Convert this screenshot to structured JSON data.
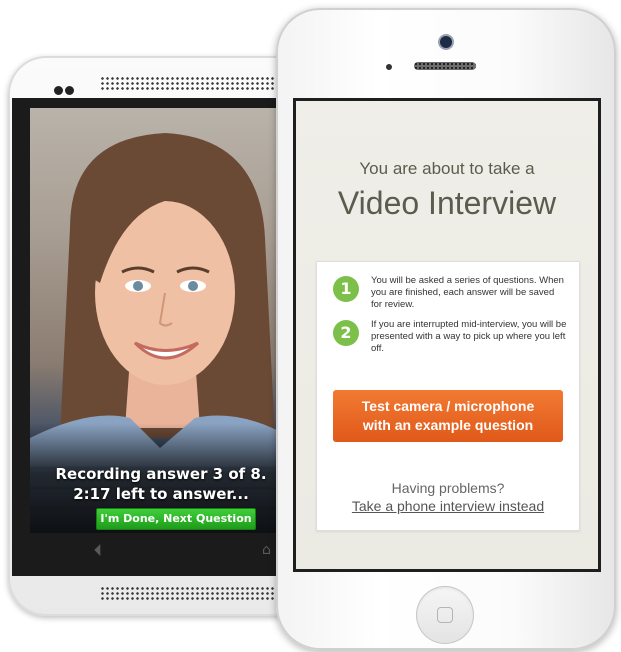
{
  "android": {
    "recording_line1": "Recording answer 3 of 8.",
    "recording_line2": "2:17 left to answer...",
    "done_button": "I'm Done, Next Question",
    "nav_back_icon": "back-triangle-icon",
    "nav_home_icon": "home-icon"
  },
  "iphone": {
    "heading_small": "You are about to take a",
    "heading_large": "Video Interview",
    "steps": [
      {
        "number": "1",
        "text": "You will be asked a series of questions. When you are finished, each answer will be saved for review."
      },
      {
        "number": "2",
        "text": "If you are interrupted mid-interview, you will be presented with a way to pick up where you left off."
      }
    ],
    "test_button_line1": "Test camera / microphone",
    "test_button_line2": "with an example question",
    "problems_text": "Having problems?",
    "phone_link": "Take a phone interview instead"
  },
  "colors": {
    "accent_orange": "#e8641f",
    "step_green": "#7cc04a",
    "done_green": "#2bb526"
  }
}
